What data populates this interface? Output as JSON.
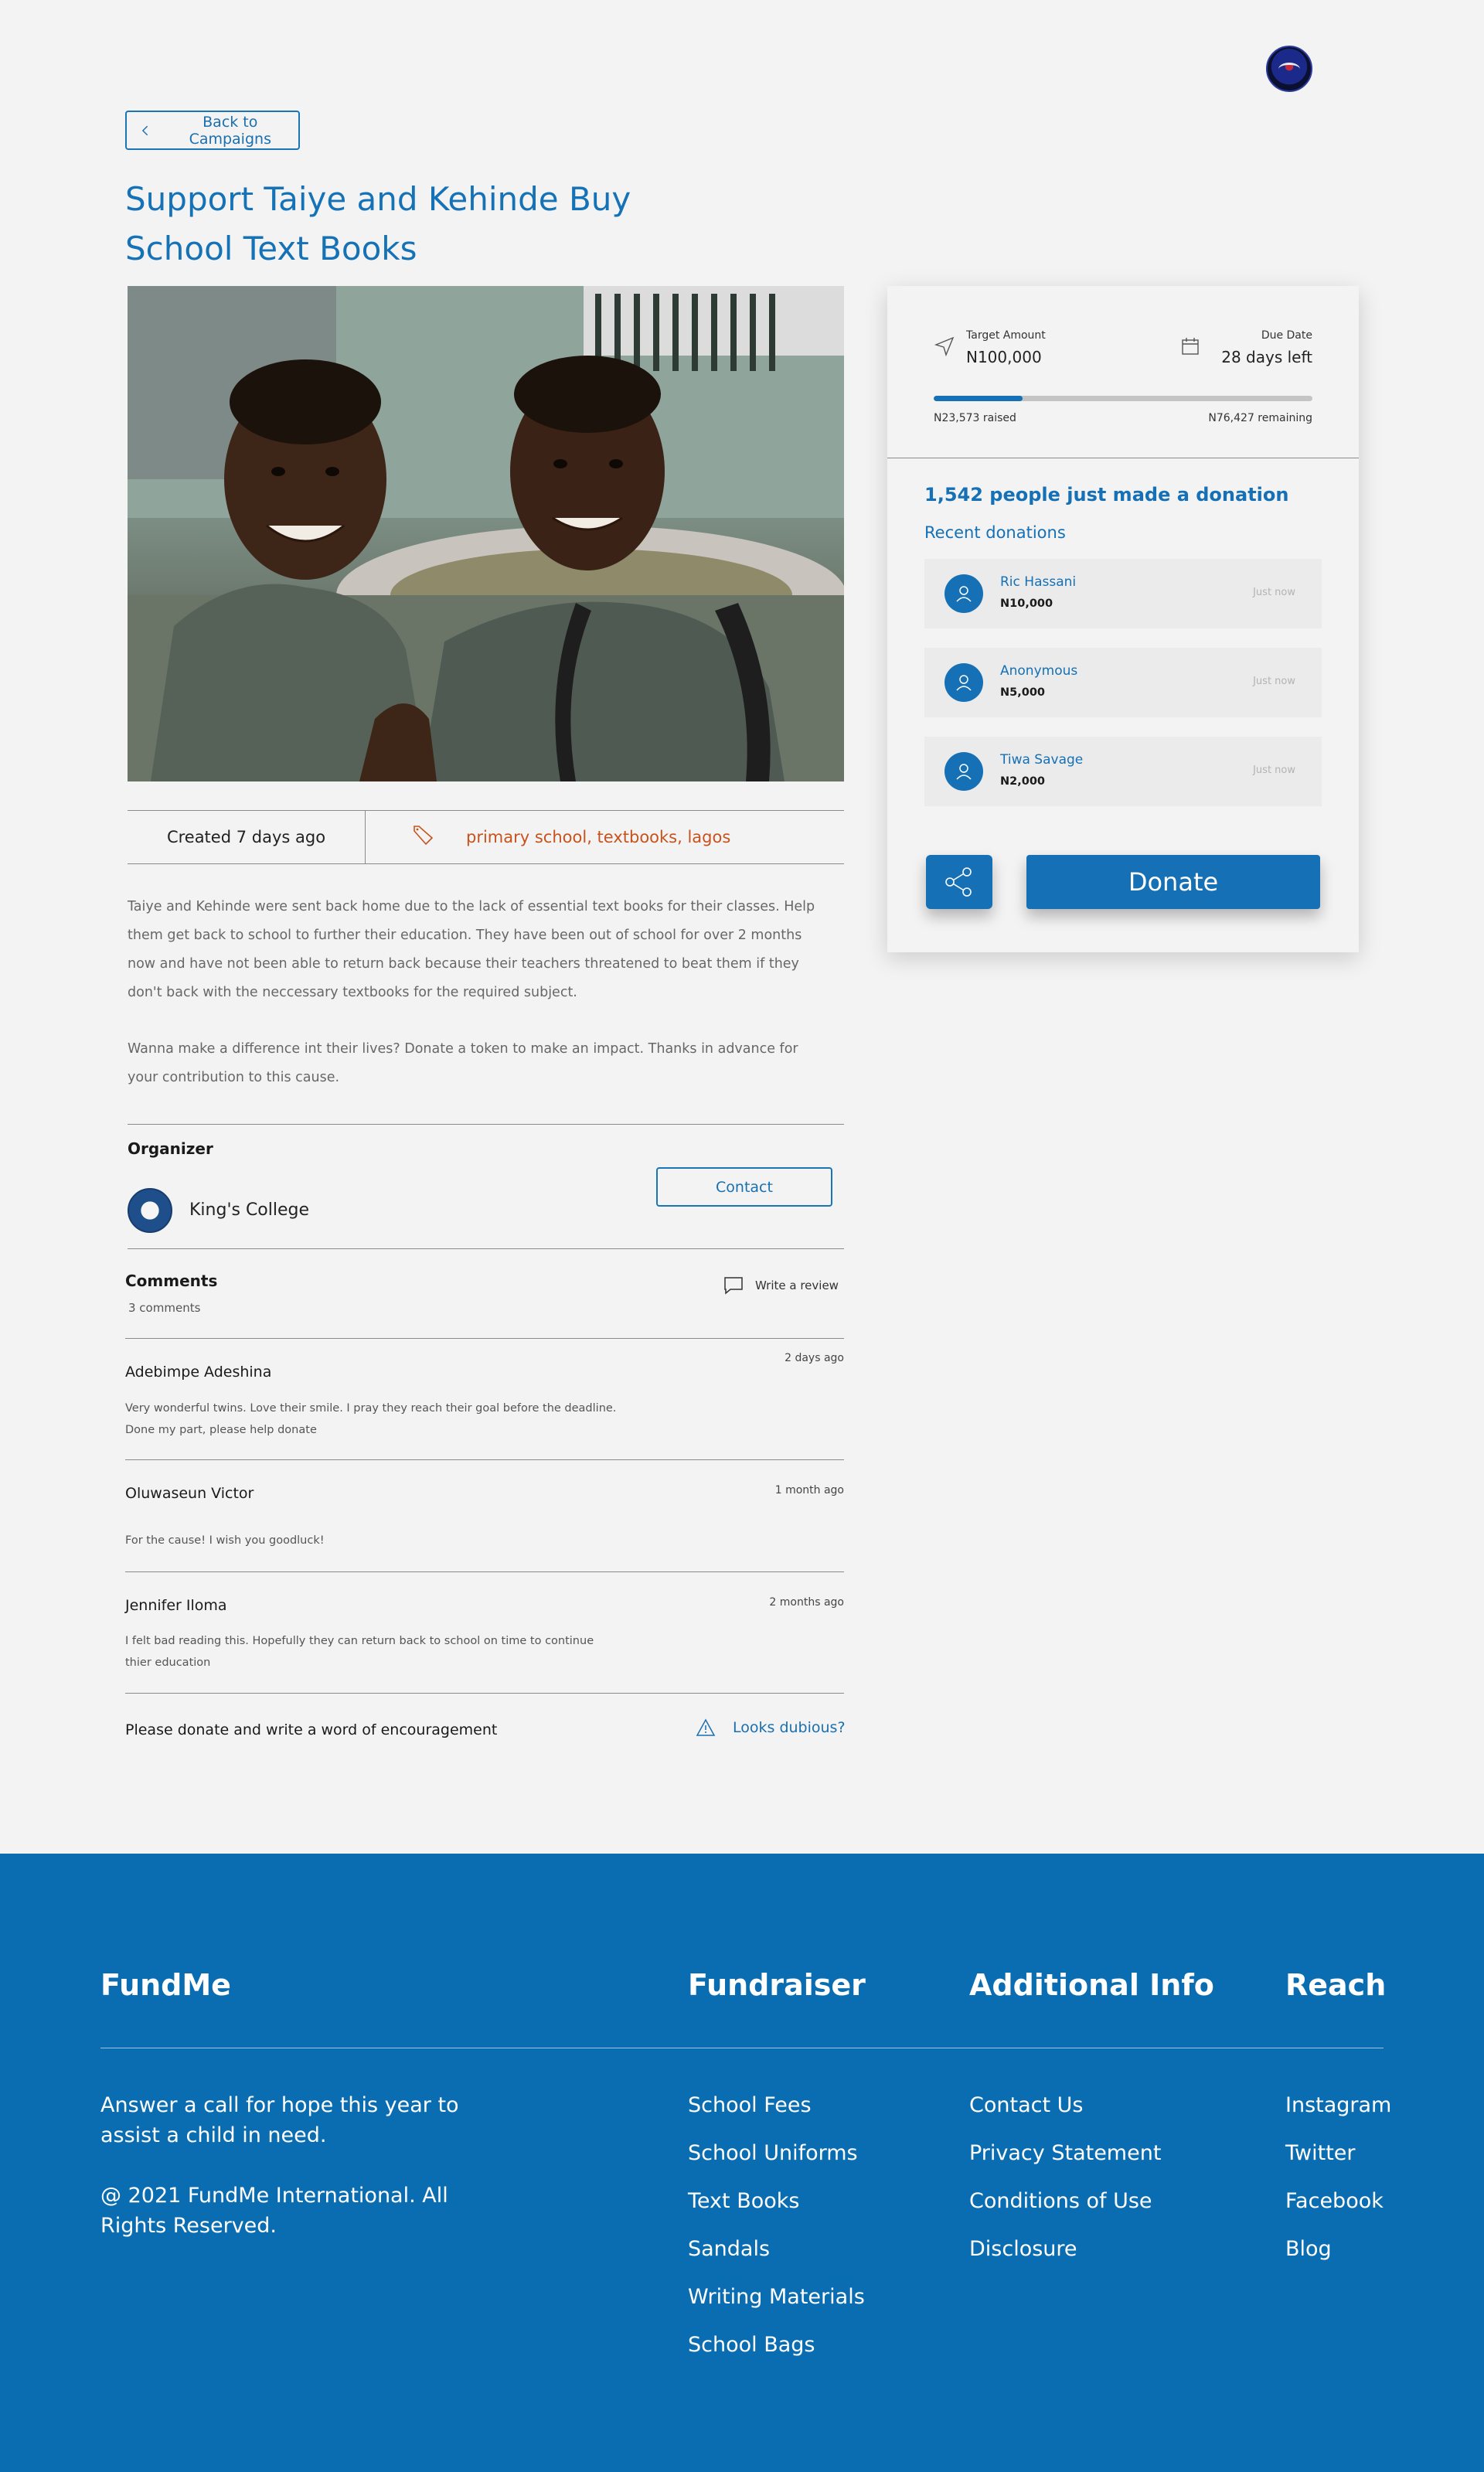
{
  "nav": {
    "back_label": "Back to Campaigns"
  },
  "campaign": {
    "title": "Support Taiye and Kehinde Buy School Text Books",
    "created": "Created 7 days ago",
    "tags": "primary school, textbooks, lagos",
    "description_1": "Taiye and Kehinde were sent back home due to the lack of essential text books for their classes. Help them get back to school to further their education. They have been out of school for over 2 months now and have not been able to return back because their teachers threatened to beat them if they don't back with the neccessary textbooks for the required subject.",
    "description_2": "Wanna make a difference int their lives? Donate a token to make an impact. Thanks in advance for your contribution to this cause."
  },
  "organizer": {
    "label": "Organizer",
    "name": "King's College",
    "contact_label": "Contact"
  },
  "comments": {
    "title": "Comments",
    "count": "3 comments",
    "write_review": "Write a review",
    "items": [
      {
        "name": "Adebimpe Adeshina",
        "date": "2 days ago",
        "text": "Very wonderful twins. Love their smile. I pray they reach their goal before the deadline. Done my part, please help donate"
      },
      {
        "name": "Oluwaseun Victor",
        "date": "1 month ago",
        "text": "For the cause! I wish you goodluck!"
      },
      {
        "name": "Jennifer Iloma",
        "date": "2 months ago",
        "text": "I felt bad reading this. Hopefully they can return back to school on time to continue thier education"
      }
    ],
    "prompt": "Please donate and write a word of encouragement",
    "dubious": "Looks dubious?"
  },
  "stats": {
    "target_label": "Target Amount",
    "target_value": "N100,000",
    "due_label": "Due Date",
    "due_value": "28 days left",
    "progress_fraction": 0.23573,
    "raised": "N23,573 raised",
    "remaining": "N76,427 remaining"
  },
  "donations": {
    "headline": "1,542 people just made a donation",
    "recent_label": "Recent donations",
    "items": [
      {
        "name": "Ric Hassani",
        "amount": "N10,000",
        "time": "Just now"
      },
      {
        "name": "Anonymous",
        "amount": "N5,000",
        "time": "Just now"
      },
      {
        "name": "Tiwa Savage",
        "amount": "N2,000",
        "time": "Just now"
      }
    ],
    "donate_label": "Donate"
  },
  "footer": {
    "brand": "FundMe",
    "tagline": "Answer a call for hope this year to assist a child in need.",
    "copyright": "@ 2021 FundMe International. All Rights Reserved.",
    "fundraiser": {
      "title": "Fundraiser",
      "items": [
        "School Fees",
        "School Uniforms",
        "Text Books",
        "Sandals",
        "Writing Materials",
        "School Bags"
      ]
    },
    "additional": {
      "title": "Additional Info",
      "items": [
        "Contact Us",
        "Privacy Statement",
        "Conditions of Use",
        "Disclosure"
      ]
    },
    "reach": {
      "title": "Reach",
      "items": [
        "Instagram",
        "Twitter",
        "Facebook",
        "Blog"
      ]
    }
  },
  "colors": {
    "brand": "#1570b5",
    "tag": "#c8521c",
    "footer_bg": "#0a6db2"
  }
}
